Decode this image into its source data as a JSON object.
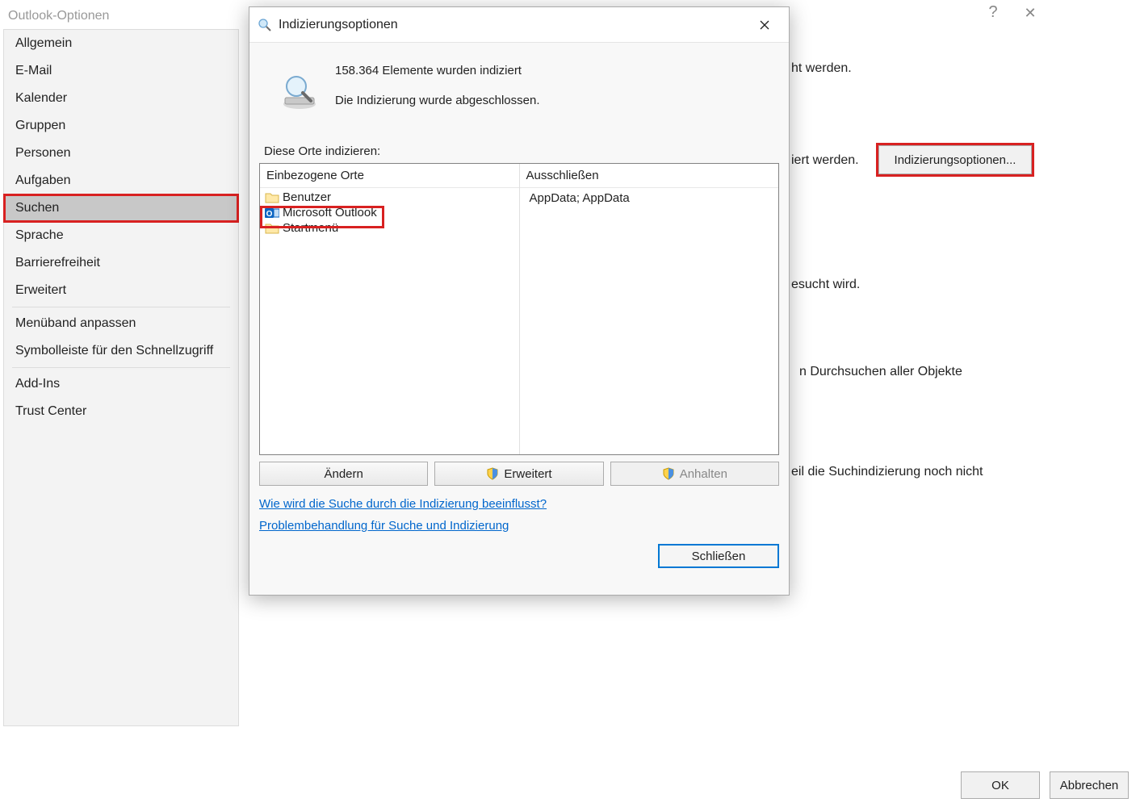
{
  "outer": {
    "title": "Outlook-Optionen",
    "help": "?",
    "close": "✕",
    "ok": "OK",
    "cancel": "Abbrechen",
    "sidebar": {
      "items": [
        "Allgemein",
        "E-Mail",
        "Kalender",
        "Gruppen",
        "Personen",
        "Aufgaben",
        "Suchen",
        "Sprache",
        "Barrierefreiheit",
        "Erweitert",
        "Menüband anpassen",
        "Symbolleiste für den Schnellzugriff",
        "Add-Ins",
        "Trust Center"
      ],
      "selected_index": 6
    },
    "main": {
      "p1": "ht werden.",
      "p2": "iert werden.",
      "p3": "esucht wird.",
      "p4": "n Durchsuchen aller Objekte",
      "p5": "eil die Suchindizierung noch nicht",
      "index_btn": "Indizierungsoptionen..."
    }
  },
  "inner": {
    "title": "Indizierungsoptionen",
    "count": "158.364 Elemente wurden indiziert",
    "done": "Die Indizierung wurde abgeschlossen.",
    "locations_label": "Diese Orte indizieren:",
    "col1": "Einbezogene Orte",
    "col2": "Ausschließen",
    "item1": "Benutzer",
    "item2": "Microsoft Outlook",
    "item3": "Startmenü",
    "excl1": "AppData; AppData",
    "btn_change": "Ändern",
    "btn_adv": "Erweitert",
    "btn_pause": "Anhalten",
    "link1": "Wie wird die Suche durch die Indizierung beeinflusst?",
    "link2": "Problembehandlung für Suche und Indizierung",
    "close": "Schließen"
  }
}
